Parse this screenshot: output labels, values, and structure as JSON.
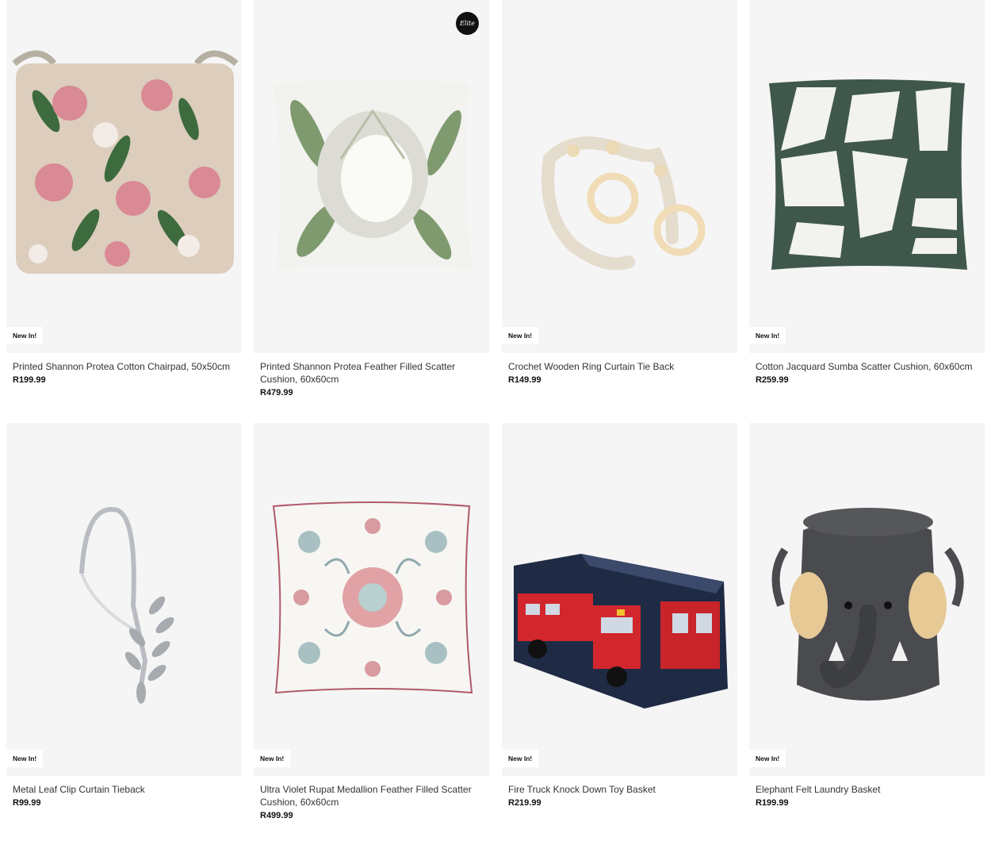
{
  "products": [
    {
      "name": "Printed Shannon Protea Cotton Chairpad, 50x50cm",
      "price": "R199.99",
      "badge": "New In!",
      "image_icon": "protea-chairpad-image"
    },
    {
      "name": "Printed Shannon Protea Feather Filled Scatter Cushion, 60x60cm",
      "price": "R479.99",
      "badge": "",
      "brand_badge": "Elite",
      "image_icon": "protea-cushion-image"
    },
    {
      "name": "Crochet Wooden Ring Curtain Tie Back",
      "price": "R149.99",
      "badge": "New In!",
      "image_icon": "crochet-tieback-image"
    },
    {
      "name": "Cotton Jacquard Sumba Scatter Cushion, 60x60cm",
      "price": "R259.99",
      "badge": "New In!",
      "image_icon": "jacquard-cushion-image"
    },
    {
      "name": "Metal Leaf Clip Curtain Tieback",
      "price": "R99.99",
      "badge": "New In!",
      "image_icon": "leaf-clip-image"
    },
    {
      "name": "Ultra Violet Rupat Medallion Feather Filled Scatter Cushion, 60x60cm",
      "price": "R499.99",
      "badge": "New In!",
      "image_icon": "medallion-cushion-image"
    },
    {
      "name": "Fire Truck Knock Down Toy Basket",
      "price": "R219.99",
      "badge": "New In!",
      "image_icon": "fire-truck-basket-image"
    },
    {
      "name": "Elephant Felt Laundry Basket",
      "price": "R199.99",
      "badge": "New In!",
      "image_icon": "elephant-basket-image"
    }
  ],
  "colors": {
    "card_bg": "#f5f5f5",
    "text": "#333333",
    "price": "#111111",
    "badge_bg": "#ffffff"
  }
}
